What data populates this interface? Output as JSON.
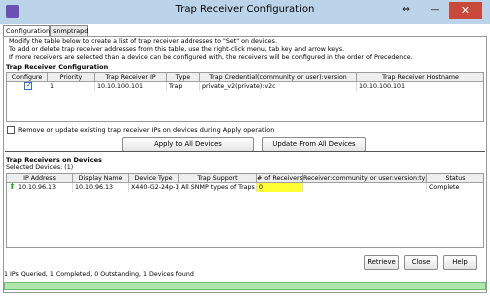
{
  "window": {
    "title": "Trap Receiver Configuration",
    "close_glyph": "✕",
    "minimize_glyph": "—",
    "restore_glyph": "⇔"
  },
  "tabs": [
    {
      "label": "Configuration"
    },
    {
      "label": "snmptrapd"
    }
  ],
  "instructions": [
    "Modify the table below to create a list of trap receiver addresses to \"Set\" on devices.",
    "To add or delete trap receiver addresses from this table, use the right-click menu, tab key and arrow keys.",
    "If more receivers are selected than a device can be configured with, the receivers will be configured in the order of Precedence."
  ],
  "config_section": {
    "title": "Trap Receiver Configuration",
    "columns": [
      "Configure",
      "Priority",
      "Trap Receiver IP",
      "Type",
      "Trap Credential(community or user):version",
      "Trap Receiver Hostname"
    ],
    "rows": [
      {
        "configure": true,
        "priority": "1",
        "ip": "10.10.100.101",
        "type": "Trap",
        "credential": "private_v2(private):v2c",
        "hostname": "10.10.100.101"
      }
    ]
  },
  "remove_option": {
    "checked": false,
    "label": "Remove or update existing trap receiver IPs on devices during Apply operation"
  },
  "buttons": {
    "apply_all": "Apply to All Devices",
    "update_from": "Update From All Devices",
    "retrieve": "Retrieve",
    "close": "Close",
    "help": "Help"
  },
  "devices_section": {
    "title": "Trap Receivers on Devices",
    "selected_label": "Selected Devices: (1)",
    "columns": [
      "IP Address",
      "Display Name",
      "Device Type",
      "Trap Support",
      "# of Receivers",
      "Receiver:community or user:version:type",
      "Status"
    ],
    "rows": [
      {
        "ip": "10.10.96.13",
        "display_name": "10.10.96.13",
        "device_type": "X440-G2-24p-1...",
        "trap_support": "All SNMP types of Traps ...",
        "receivers": "0",
        "receiver_detail": "",
        "status": "Complete"
      }
    ]
  },
  "status_text": "1 IPs Queried, 1 Completed, 0 Outstanding, 1 Devices found",
  "progress_fraction": 1.0,
  "colors": {
    "titlebar": "#bcd4ea",
    "close_button": "#c94a3b",
    "highlight": "#ffff33",
    "progress": "#aee8ae",
    "device_up_arrow": "#2aa52a"
  }
}
